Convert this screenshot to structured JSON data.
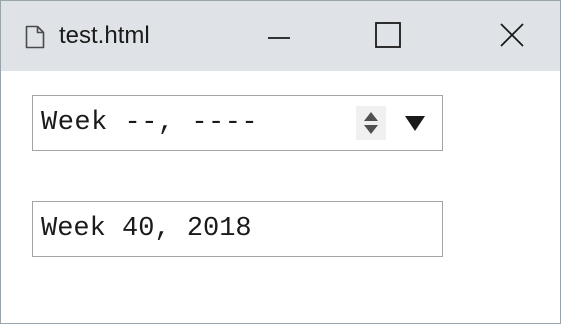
{
  "window": {
    "title": "test.html",
    "controls": {
      "minimize_icon": "minimize-icon",
      "maximize_icon": "maximize-icon",
      "close_icon": "close-icon"
    }
  },
  "inputs": {
    "empty_week": {
      "value": "Week --, ----",
      "spinner_icon": "spinner-updown-icon",
      "dropdown_icon": "dropdown-triangle-icon"
    },
    "filled_week": {
      "value": "Week 40, 2018"
    }
  },
  "colors": {
    "titlebar_bg": "#dfe3e7",
    "window_border": "#9aa4ad",
    "field_border": "#a5a5a5",
    "spinner_bg": "#f0f0f0",
    "text": "#1a1a1a"
  }
}
